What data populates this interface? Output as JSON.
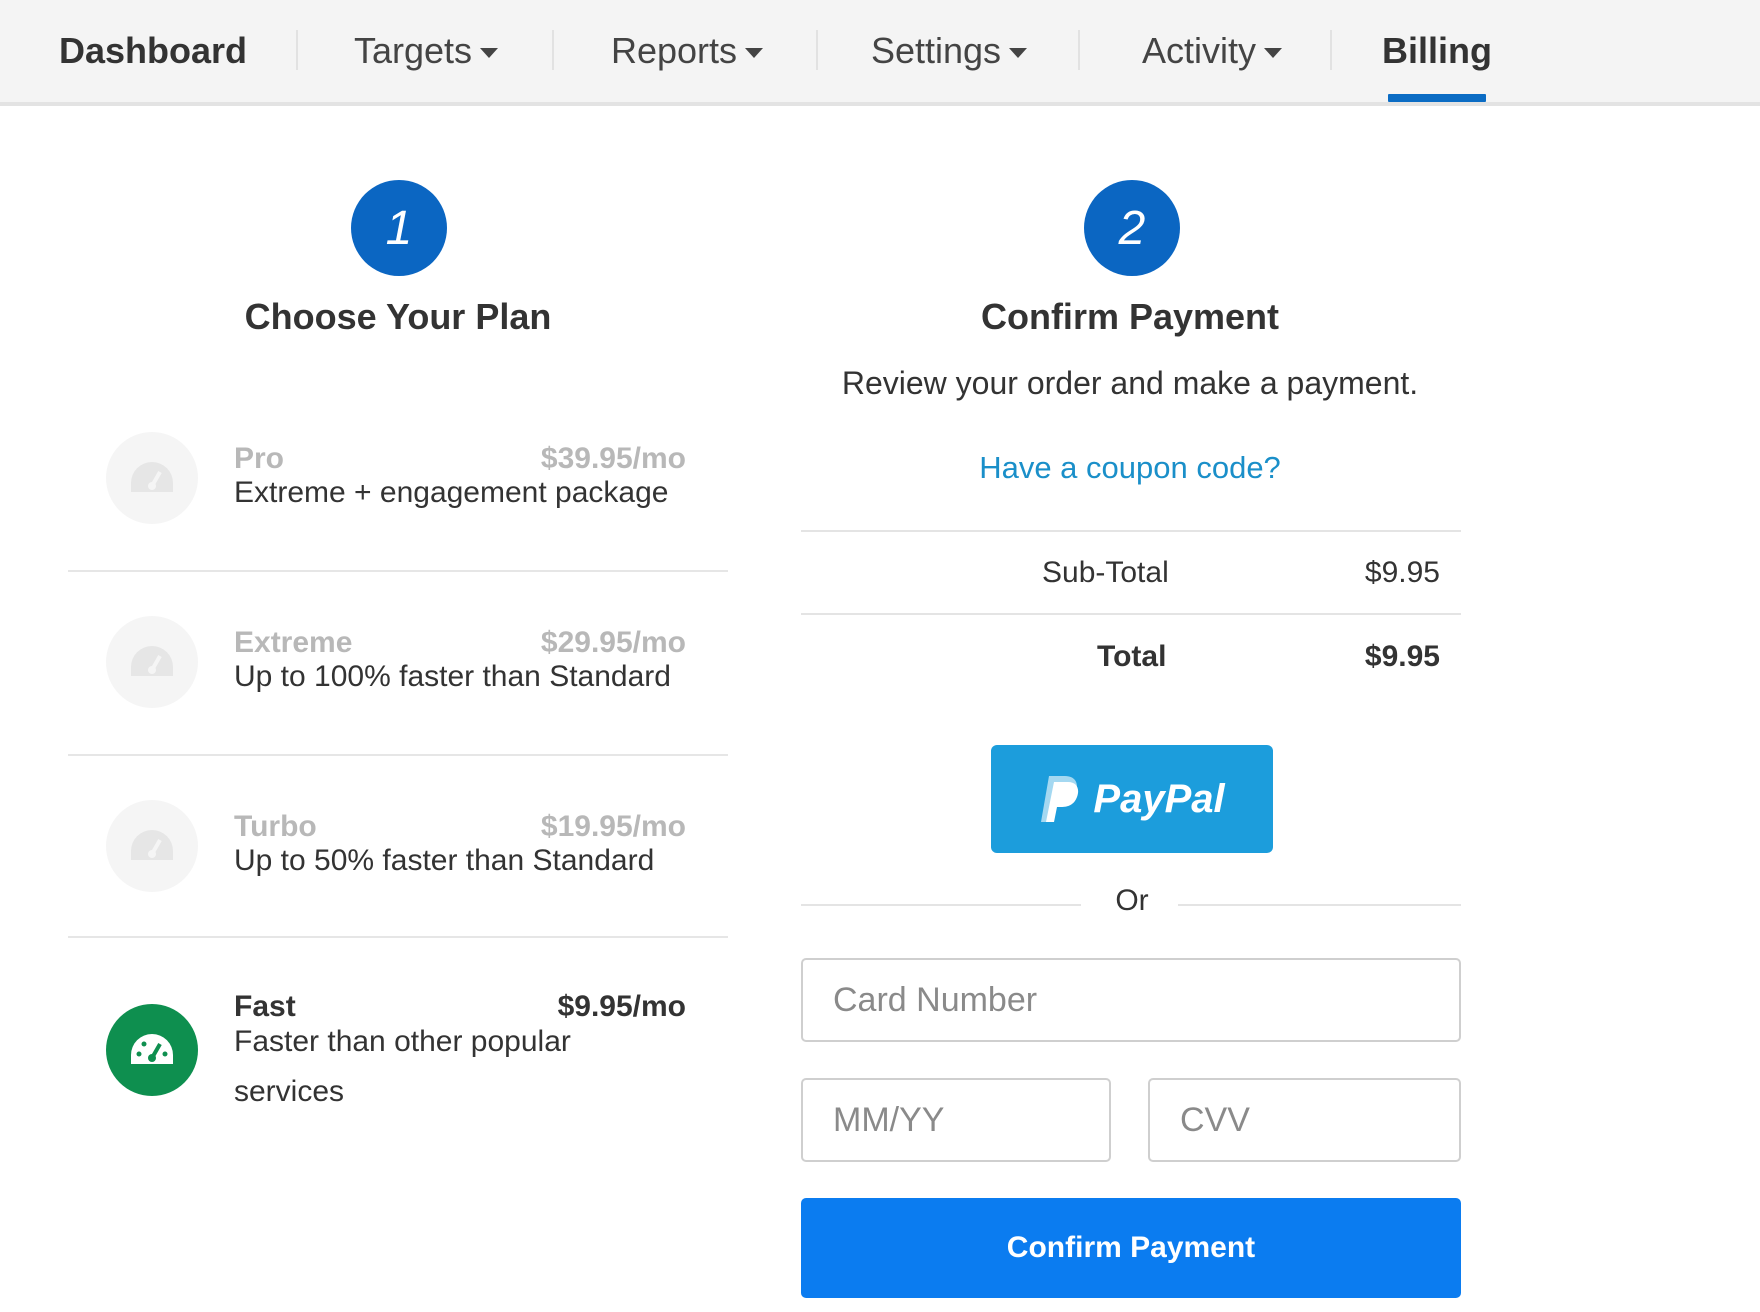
{
  "nav": {
    "items": [
      {
        "label": "Dashboard",
        "dropdown": false
      },
      {
        "label": "Targets",
        "dropdown": true
      },
      {
        "label": "Reports",
        "dropdown": true
      },
      {
        "label": "Settings",
        "dropdown": true
      },
      {
        "label": "Activity",
        "dropdown": true
      },
      {
        "label": "Billing",
        "dropdown": false,
        "active": true
      }
    ]
  },
  "steps": [
    {
      "number": "1",
      "title": "Choose Your Plan"
    },
    {
      "number": "2",
      "title": "Confirm Payment"
    }
  ],
  "plans": [
    {
      "name": "Pro",
      "price": "$39.95/mo",
      "description": "Extreme + engagement package",
      "selected": false
    },
    {
      "name": "Extreme",
      "price": "$29.95/mo",
      "description": "Up to 100% faster than Standard",
      "selected": false
    },
    {
      "name": "Turbo",
      "price": "$19.95/mo",
      "description": "Up to 50% faster than Standard",
      "selected": false
    },
    {
      "name": "Fast",
      "price": "$9.95/mo",
      "description": "Faster than other popular services",
      "selected": true
    }
  ],
  "payment": {
    "subtitle": "Review your order and make a payment.",
    "coupon_link": "Have a coupon code?",
    "subtotal_label": "Sub-Total",
    "subtotal_value": "$9.95",
    "total_label": "Total",
    "total_value": "$9.95",
    "paypal_label": "PayPal",
    "or_label": "Or",
    "card_number_placeholder": "Card Number",
    "expiry_placeholder": "MM/YY",
    "cvv_placeholder": "CVV",
    "confirm_label": "Confirm Payment"
  },
  "colors": {
    "primary": "#0b66c2",
    "button": "#0b7cf0",
    "paypal": "#1c9ddc",
    "selected_plan": "#0e8f4f",
    "link": "#1a8fc9"
  },
  "icons": {
    "plan_icon": "speedometer-icon",
    "paypal_icon": "paypal-logo-icon"
  }
}
